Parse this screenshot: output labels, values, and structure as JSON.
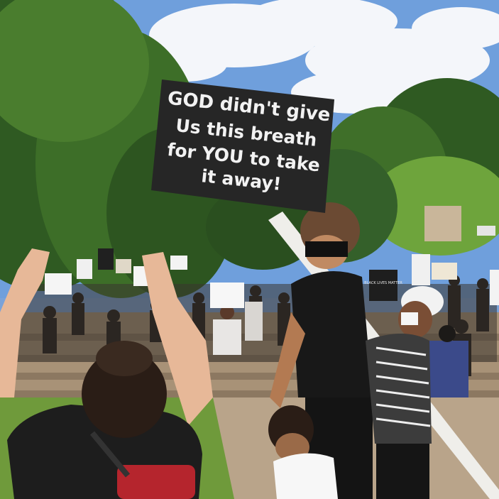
{
  "scene": {
    "sign": {
      "lines": [
        "GOD didn't give",
        "Us this breath",
        "for YOU to take",
        "it away!"
      ]
    },
    "small_signs": {
      "black_lives_matter": "BLACK LIVES MATTER"
    },
    "colors": {
      "sky": "#6f9fdc",
      "cloud": "#f4f6fa",
      "tree_dark": "#2f5a22",
      "tree_light": "#6ea43c",
      "grass": "#6f9a3b",
      "concrete": "#b9a48a",
      "sign_board": "#262626",
      "sign_text": "#f2f2f2"
    }
  }
}
